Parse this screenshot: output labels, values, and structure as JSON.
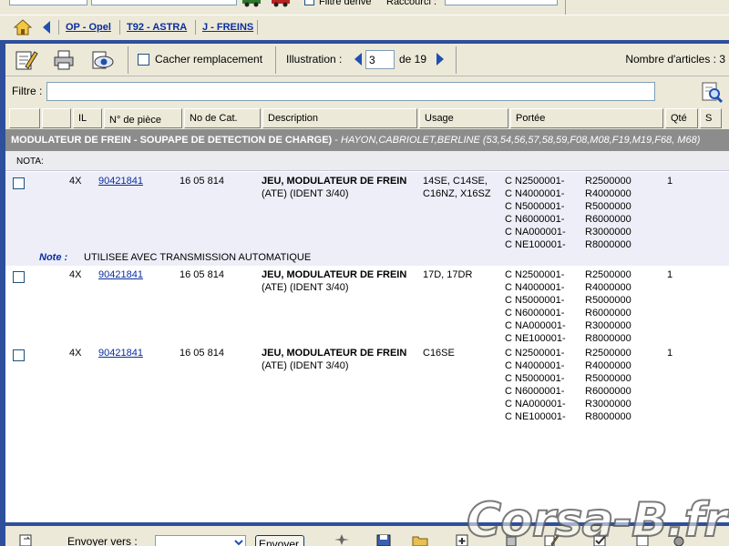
{
  "top": {
    "filter_label": "Filtre dérivé",
    "raccourci_label": "Raccourci :"
  },
  "breadcrumb": {
    "items": [
      "OP - Opel",
      "T92 - ASTRA",
      "J - FREINS"
    ]
  },
  "toolbar": {
    "hide_replacement_label": "Cacher remplacement",
    "illustration_label": "Illustration :",
    "page_value": "3",
    "page_total": "de 19",
    "article_count": "Nombre d'articles : 3"
  },
  "filter": {
    "label": "Filtre :",
    "value": ""
  },
  "columns": [
    "",
    "",
    "IL",
    "N° de pièce",
    "No de Cat.",
    "Description",
    "Usage",
    "Portée",
    "Qté",
    "S"
  ],
  "section": {
    "title": "MODULATEUR DE FREIN - SOUPAPE DE DETECTION DE CHARGE)",
    "separator": " - ",
    "subtitle": "HAYON,CABRIOLET,BERLINE (53,54,56,57,58,59,F08,M08,F19,M19,F68, M68)",
    "nota_label": "NOTA:"
  },
  "rows": [
    {
      "il": "4X",
      "part_no": "90421841",
      "cat_no": "16 05 814",
      "desc_bold": "JEU, MODULATEUR DE FREIN",
      "desc_sub": "(ATE) (IDENT 3/40)",
      "usage1": "14SE, C14SE,",
      "usage2": "C16NZ, X16SZ",
      "range": [
        "C N2500001-",
        "C N4000001-",
        "C N5000001-",
        "C N6000001-",
        "C NA000001-",
        "C NE100001-"
      ],
      "range2": [
        "R2500000",
        "R4000000",
        "R5000000",
        "R6000000",
        "R3000000",
        "R8000000"
      ],
      "qty": "1",
      "note_label": "Note :",
      "note_text": "UTILISEE AVEC TRANSMISSION AUTOMATIQUE"
    },
    {
      "il": "4X",
      "part_no": "90421841",
      "cat_no": "16 05 814",
      "desc_bold": "JEU, MODULATEUR DE FREIN",
      "desc_sub": "(ATE) (IDENT 3/40)",
      "usage1": "17D, 17DR",
      "usage2": "",
      "range": [
        "C N2500001-",
        "C N4000001-",
        "C N5000001-",
        "C N6000001-",
        "C NA000001-",
        "C NE100001-"
      ],
      "range2": [
        "R2500000",
        "R4000000",
        "R5000000",
        "R6000000",
        "R3000000",
        "R8000000"
      ],
      "qty": "1"
    },
    {
      "il": "4X",
      "part_no": "90421841",
      "cat_no": "16 05 814",
      "desc_bold": "JEU, MODULATEUR DE FREIN",
      "desc_sub": "(ATE) (IDENT 3/40)",
      "usage1": "C16SE",
      "usage2": "",
      "range": [
        "C N2500001-",
        "C N4000001-",
        "C N5000001-",
        "C N6000001-",
        "C NA000001-",
        "C NE100001-"
      ],
      "range2": [
        "R2500000",
        "R4000000",
        "R5000000",
        "R6000000",
        "R3000000",
        "R8000000"
      ],
      "qty": "1"
    }
  ],
  "bottom": {
    "send_label": "Envoyer vers :",
    "send_button": "Envoyer"
  },
  "watermark": "Corsa-B.fr",
  "colors": {
    "accent_blue": "#2e4f9c",
    "link_blue": "#0a2d9e",
    "section_gray": "#8c8c8c",
    "row_alt": "#eeeef8"
  }
}
